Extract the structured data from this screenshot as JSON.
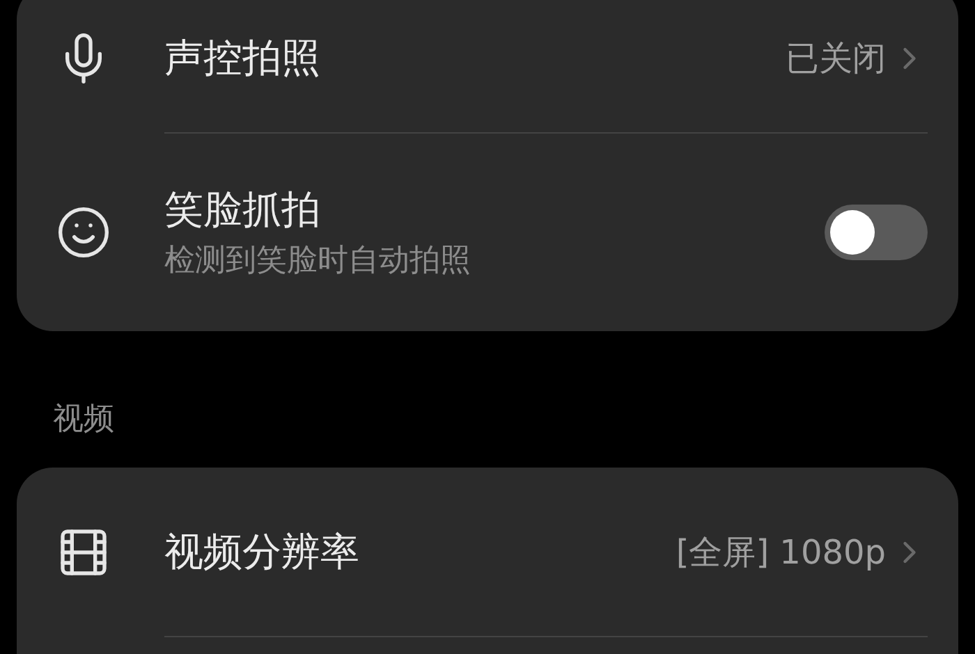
{
  "cards": [
    {
      "items": [
        {
          "kind": "link",
          "title": "声控拍照",
          "value": "已关闭"
        },
        {
          "kind": "toggle",
          "title": "笑脸抓拍",
          "subtitle": "检测到笑脸时自动拍照",
          "on": false
        }
      ]
    },
    {
      "header": "视频",
      "items": [
        {
          "kind": "link",
          "title": "视频分辨率",
          "value": "[全屏] 1080p"
        }
      ]
    }
  ]
}
